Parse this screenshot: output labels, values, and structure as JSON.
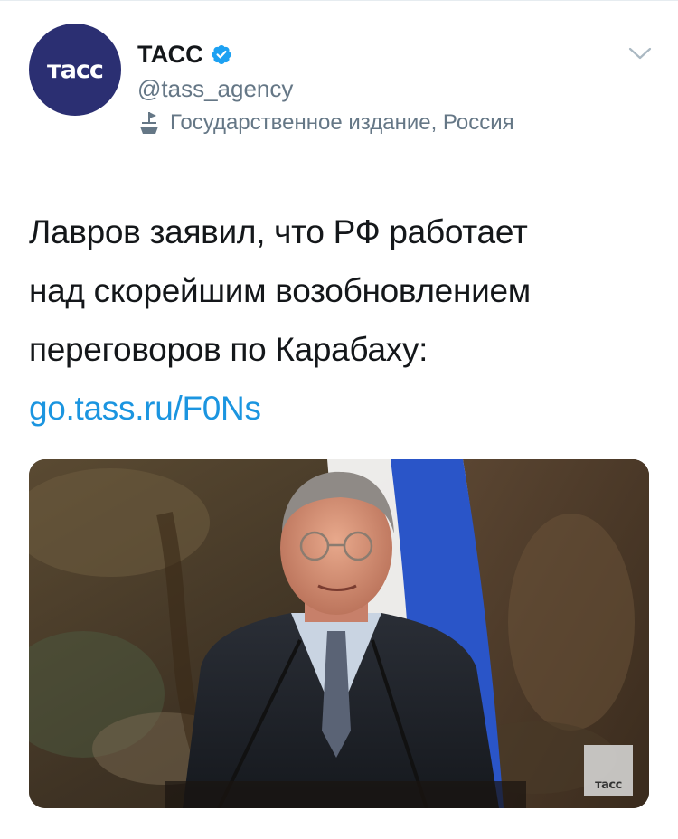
{
  "account": {
    "avatar_text": "тасс",
    "name": "ТАСС",
    "handle": "@tass_agency",
    "label": "Государственное издание, Россия"
  },
  "tweet": {
    "lines": [
      "Лавров заявил, что РФ работает",
      "над скорейшим возобновлением",
      "переговоров по Карабаху:"
    ],
    "link": "go.tass.ru/F0Ns"
  },
  "media": {
    "watermark": "тасс"
  },
  "colors": {
    "text": "#14171a",
    "secondary": "#657786",
    "link": "#1b95e0",
    "verified": "#1da1f2",
    "avatar_bg": "#2b2f72"
  },
  "icons": [
    "verified-badge-icon",
    "state-media-icon",
    "chevron-down-icon"
  ]
}
